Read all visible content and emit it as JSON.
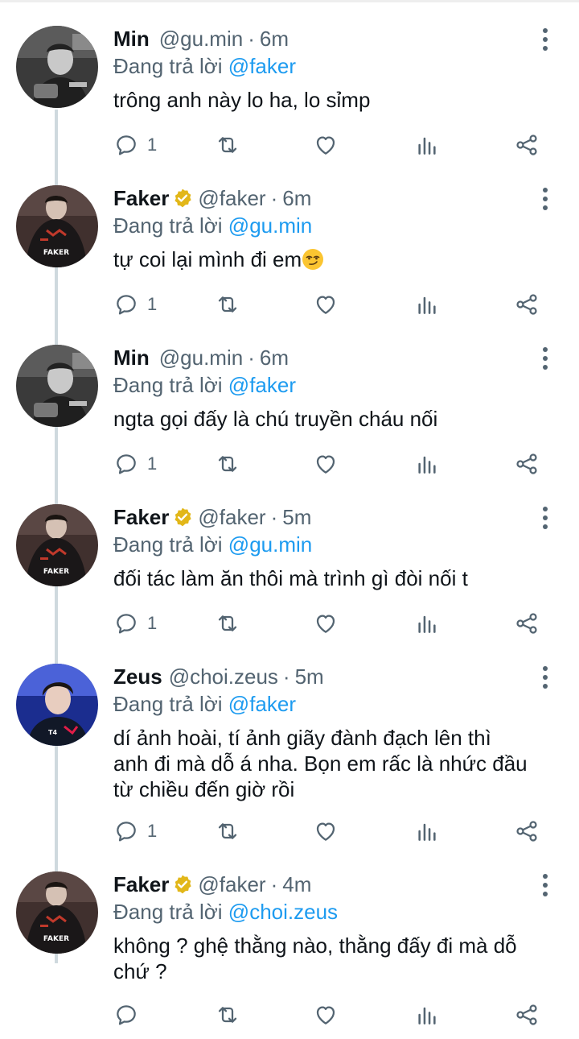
{
  "reply_prefix": "Đang trả lời",
  "icons": {
    "reply": "reply-icon",
    "retweet": "retweet-icon",
    "like": "heart-icon",
    "views": "views-icon",
    "share": "share-icon",
    "more": "more-options-icon",
    "verified": "verified-badge-icon"
  },
  "colors": {
    "mention": "#1d9bf0",
    "secondary": "#536471",
    "verified": "#e2b719"
  },
  "tweets": [
    {
      "name": "Min",
      "handle": "@gu.min",
      "time": "6m",
      "replying_to": "@faker",
      "text": "trông anh này lo ha, lo sỉmp",
      "reply_count": "1"
    },
    {
      "name": "Faker",
      "handle": "@faker",
      "time": "6m",
      "replying_to": "@gu.min",
      "text": "tự coi lại mình đi em",
      "emoji": "smirk",
      "reply_count": "1"
    },
    {
      "name": "Min",
      "handle": "@gu.min",
      "time": "6m",
      "replying_to": "@faker",
      "text": "ngta gọi đấy là chú truyền cháu nối",
      "reply_count": "1"
    },
    {
      "name": "Faker",
      "handle": "@faker",
      "time": "5m",
      "replying_to": "@gu.min",
      "text": "đối tác làm ăn thôi mà trình gì đòi nối t",
      "reply_count": "1"
    },
    {
      "name": "Zeus",
      "handle": "@choi.zeus",
      "time": "5m",
      "replying_to": "@faker",
      "text": "dí ảnh hoài, tí ảnh giãy đành đạch lên thì anh đi mà dỗ á nha. Bọn em rấc là nhức đầu từ chiều đến giờ rồi",
      "reply_count": "1"
    },
    {
      "name": "Faker",
      "handle": "@faker",
      "time": "4m",
      "replying_to": "@choi.zeus",
      "text": "không ? ghệ thằng nào, thằng đấy đi mà dỗ chứ ?",
      "reply_count": ""
    }
  ]
}
